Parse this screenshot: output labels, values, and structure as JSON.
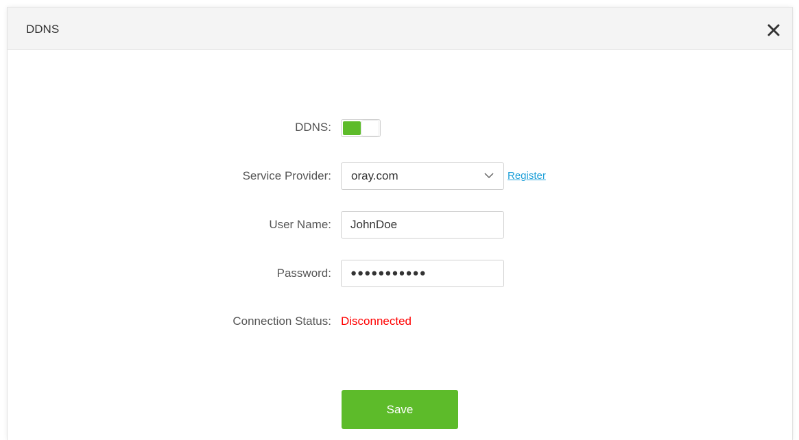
{
  "dialog": {
    "title": "DDNS",
    "close_icon": "close-icon"
  },
  "form": {
    "ddns": {
      "label": "DDNS:",
      "enabled": true
    },
    "service_provider": {
      "label": "Service Provider:",
      "value": "oray.com",
      "register_label": "Register"
    },
    "user_name": {
      "label": "User Name:",
      "value": "JohnDoe"
    },
    "password": {
      "label": "Password:",
      "masked_value": "●●●●●●●●●●●"
    },
    "connection_status": {
      "label": "Connection Status:",
      "value": "Disconnected"
    }
  },
  "actions": {
    "save_label": "Save"
  },
  "colors": {
    "accent_green": "#5dbb2a",
    "link_blue": "#1a9ed8",
    "status_red": "#ff0000",
    "header_bg": "#f4f4f4"
  }
}
